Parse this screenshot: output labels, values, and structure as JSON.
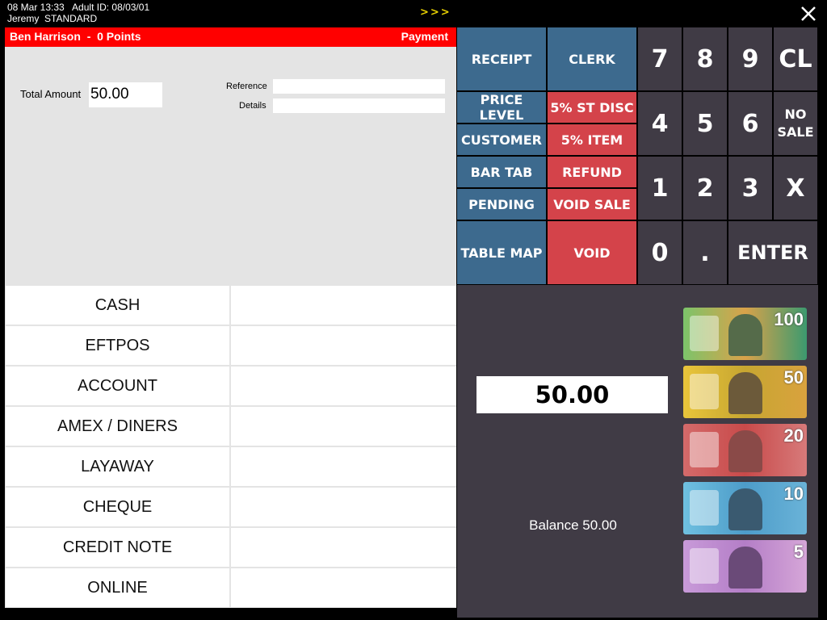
{
  "header": {
    "datetime_id": "08 Mar 13:33   Adult ID: 08/03/01",
    "user_line": "Jeremy  STANDARD",
    "more": ">>>"
  },
  "customer": {
    "name_points": "Ben Harrison  -  0 Points",
    "mode": "Payment"
  },
  "payment_info": {
    "total_label": "Total Amount",
    "total_value": "50.00",
    "reference_label": "Reference",
    "reference_value": "",
    "details_label": "Details",
    "details_value": ""
  },
  "tenders": [
    "CASH",
    "EFTPOS",
    "ACCOUNT",
    "AMEX / DINERS",
    "LAYAWAY",
    "CHEQUE",
    "CREDIT NOTE",
    "ONLINE"
  ],
  "functions": {
    "receipt": "RECEIPT",
    "clerk": "CLERK",
    "price_level": "PRICE LEVEL",
    "st_disc": "5% ST DISC",
    "customer": "CUSTOMER",
    "item_disc": "5% ITEM",
    "bar_tab": "BAR TAB",
    "refund": "REFUND",
    "pending": "PENDING",
    "void_sale": "VOID SALE",
    "table_map": "TABLE MAP",
    "void": "VOID"
  },
  "keypad": {
    "k7": "7",
    "k8": "8",
    "k9": "9",
    "cl": "CL",
    "k4": "4",
    "k5": "5",
    "k6": "6",
    "no_sale_1": "NO",
    "no_sale_2": "SALE",
    "k1": "1",
    "k2": "2",
    "k3": "3",
    "x": "X",
    "k0": "0",
    "dot": ".",
    "enter": "ENTER"
  },
  "cash": {
    "amount": "50.00",
    "balance": "Balance 50.00",
    "notes": [
      "100",
      "50",
      "20",
      "10",
      "5"
    ]
  },
  "colors": {
    "function_blue": "#3d6a8e",
    "function_red": "#d4434a",
    "keypad_bg": "#403b45",
    "customer_bar": "#ff0000"
  }
}
